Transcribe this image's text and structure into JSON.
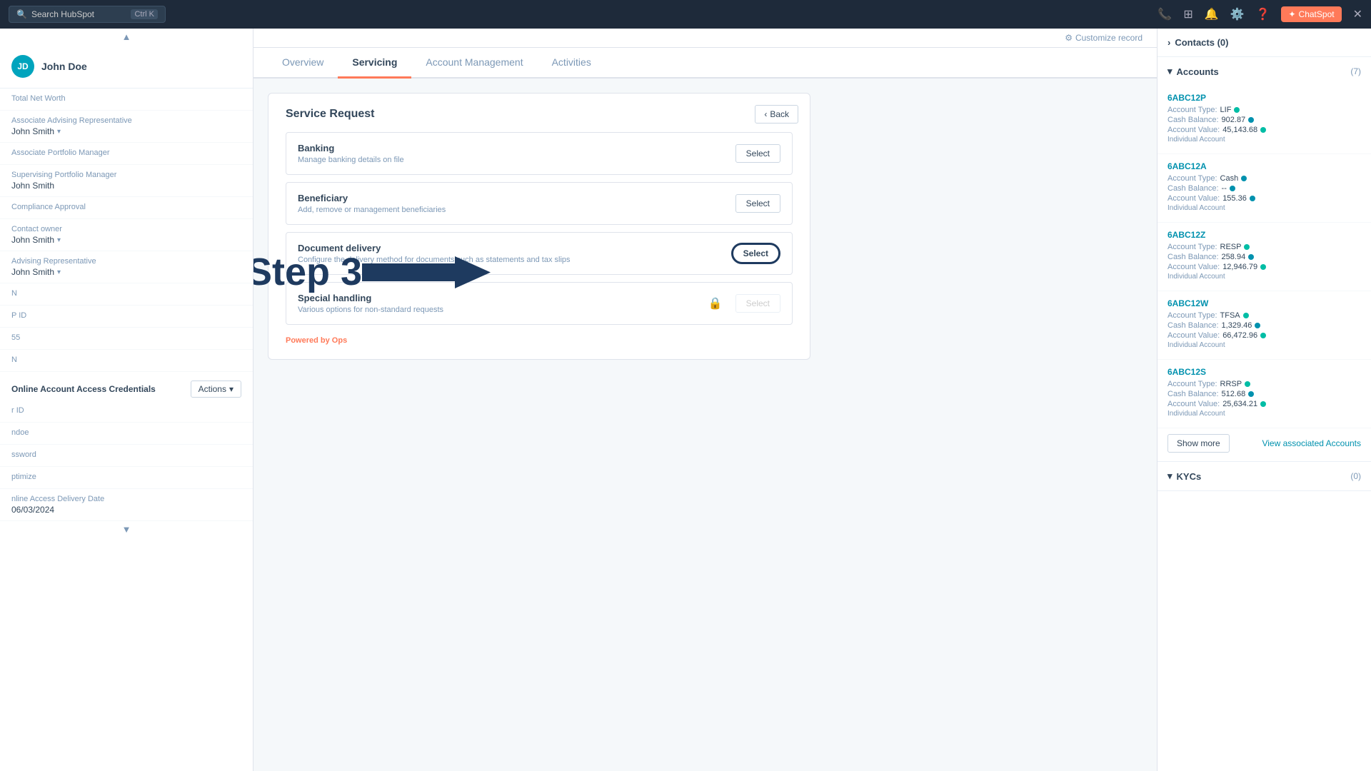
{
  "topnav": {
    "search_placeholder": "Search HubSpot",
    "shortcut_ctrl": "Ctrl",
    "shortcut_key": "K",
    "chatspot_label": "ChatSpot"
  },
  "contact": {
    "name": "John Doe",
    "initials": "JD"
  },
  "sidebar": {
    "fields": [
      {
        "label": "Total Net Worth",
        "value": ""
      },
      {
        "label": "Associate Advising Representative",
        "value": "John Smith",
        "dropdown": true
      },
      {
        "label": "Associate Portfolio Manager",
        "value": ""
      },
      {
        "label": "Supervising Portfolio Manager",
        "value": "John Smith",
        "dropdown": false
      },
      {
        "label": "Compliance Approval",
        "value": ""
      },
      {
        "label": "Contact owner",
        "value": "John Smith",
        "dropdown": true
      },
      {
        "label": "Advising Representative",
        "value": "John Smith",
        "dropdown": true
      },
      {
        "label": "N",
        "value": ""
      },
      {
        "label": "P ID",
        "value": ""
      },
      {
        "label": "55",
        "value": ""
      },
      {
        "label": "N",
        "value": ""
      }
    ],
    "online_credentials_section": "Online Account Access Credentials",
    "actions_label": "Actions",
    "cred_fields": [
      {
        "label": "r ID",
        "value": ""
      },
      {
        "label": "ndoe",
        "value": ""
      },
      {
        "label": "ssword",
        "value": ""
      },
      {
        "label": "ptimize",
        "value": ""
      },
      {
        "label": "nline Access Delivery Date",
        "value": "06/03/2024"
      }
    ]
  },
  "tabs": [
    {
      "label": "Overview",
      "active": false
    },
    {
      "label": "Servicing",
      "active": true
    },
    {
      "label": "Account Management",
      "active": false
    },
    {
      "label": "Activities",
      "active": false
    }
  ],
  "customize_record": "Customize record",
  "service_request": {
    "title": "Service Request",
    "back_label": "Back",
    "items": [
      {
        "id": "banking",
        "title": "Banking",
        "description": "Manage banking details on file",
        "button_label": "Select",
        "highlighted": false,
        "locked": false
      },
      {
        "id": "beneficiary",
        "title": "Beneficiary",
        "description": "Add, remove or management beneficiaries",
        "button_label": "Select",
        "highlighted": false,
        "locked": false
      },
      {
        "id": "document-delivery",
        "title": "Document delivery",
        "description": "Configure the delivery method for documents such as statements and tax slips",
        "button_label": "Select",
        "highlighted": true,
        "locked": false
      },
      {
        "id": "special-handling",
        "title": "Special handling",
        "description": "Various options for non-standard requests",
        "button_label": "Select",
        "highlighted": false,
        "locked": true
      }
    ],
    "powered_by_prefix": "Powered by ",
    "powered_by_brand": "Ops"
  },
  "step_annotation": "Step 3",
  "right_panel": {
    "contacts_label": "Contacts (0)",
    "accounts_label": "Accounts",
    "accounts_count": "7",
    "accounts": [
      {
        "id": "6ABC12P",
        "type_label": "Account Type:",
        "type_value": "LIF",
        "cash_label": "Cash Balance:",
        "cash_value": "902.87",
        "value_label": "Account Value:",
        "account_value": "45,143.68",
        "subtype": "Individual Account",
        "dot_color": "green"
      },
      {
        "id": "6ABC12A",
        "type_label": "Account Type:",
        "type_value": "Cash",
        "cash_label": "Cash Balance:",
        "cash_value": "--",
        "value_label": "Account Value:",
        "account_value": "155.36",
        "subtype": "Individual Account",
        "dot_color": "blue"
      },
      {
        "id": "6ABC12Z",
        "type_label": "Account Type:",
        "type_value": "RESP",
        "cash_label": "Cash Balance:",
        "cash_value": "258.94",
        "value_label": "Account Value:",
        "account_value": "12,946.79",
        "subtype": "Individual Account",
        "dot_color": "green"
      },
      {
        "id": "6ABC12W",
        "type_label": "Account Type:",
        "type_value": "TFSA",
        "cash_label": "Cash Balance:",
        "cash_value": "1,329.46",
        "value_label": "Account Value:",
        "account_value": "66,472.96",
        "subtype": "Individual Account",
        "dot_color": "green"
      },
      {
        "id": "6ABC12S",
        "type_label": "Account Type:",
        "type_value": "RRSP",
        "cash_label": "Cash Balance:",
        "cash_value": "512.68",
        "value_label": "Account Value:",
        "account_value": "25,634.21",
        "subtype": "Individual Account",
        "dot_color": "green"
      }
    ],
    "show_more_label": "Show more",
    "view_associated_label": "View associated Accounts",
    "kycs_label": "KYCs",
    "kycs_count": "0"
  }
}
